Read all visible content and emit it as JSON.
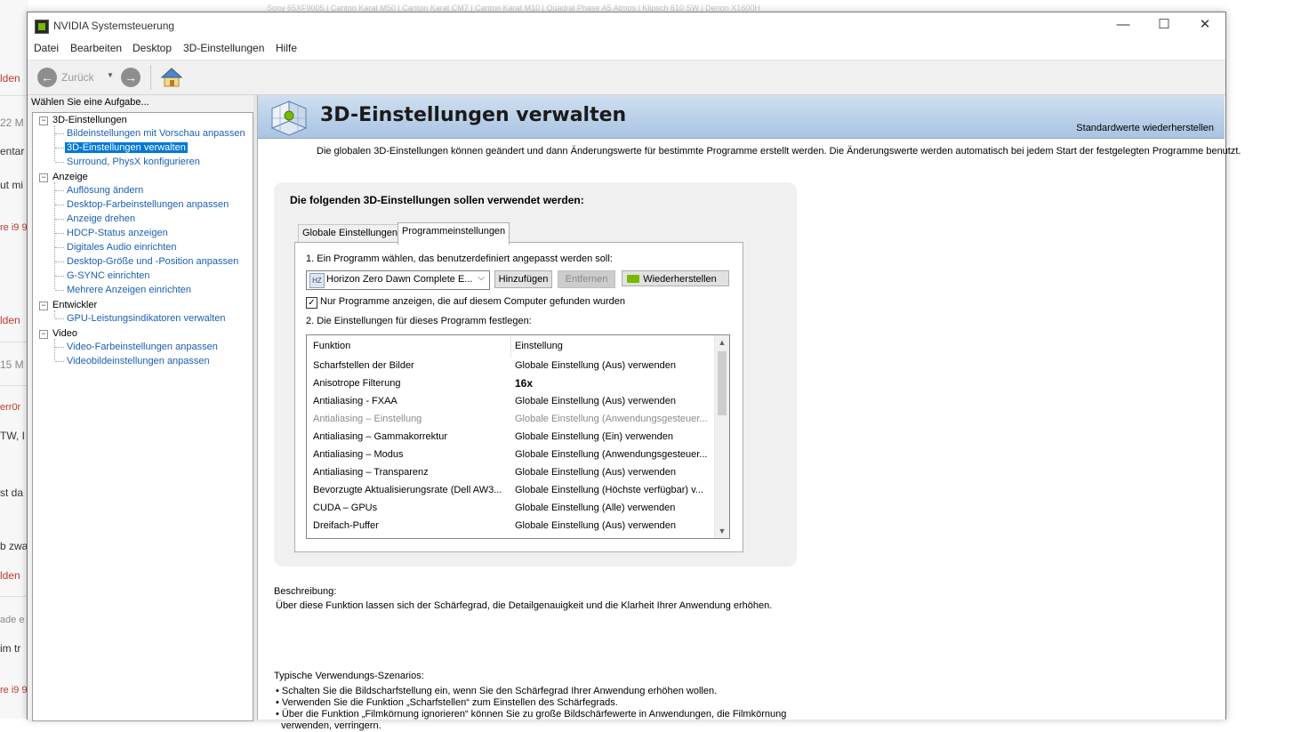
{
  "background": {
    "top_line": "Sony 65XF9005 | Canton Karat M50 | Canton Karat CM7 | Canton Karat M10 | Quadral Phase A5 Atmos | Klipsch 610 SW | Denon X1600H",
    "fragments": [
      "lden",
      "22 M",
      "entar",
      "ut mi",
      "re i9 9",
      "lden",
      "15 M",
      "err0r",
      "TW, I",
      "st da",
      "b zwa",
      "lden",
      "ade e",
      "im tr",
      "re i9 9"
    ]
  },
  "window": {
    "title": "NVIDIA Systemsteuerung",
    "controls": {
      "minimize": "—",
      "maximize": "☐",
      "close": "✕"
    }
  },
  "menu": [
    "Datei",
    "Bearbeiten",
    "Desktop",
    "3D-Einstellungen",
    "Hilfe"
  ],
  "toolbar": {
    "back_label": "Zurück",
    "back_icon": "back-arrow-icon",
    "forward_icon": "forward-arrow-icon",
    "home_icon": "home-icon"
  },
  "sidebar": {
    "header": "Wählen Sie eine Aufgabe...",
    "categories": [
      {
        "label": "3D-Einstellungen",
        "items": [
          "Bildeinstellungen mit Vorschau anpassen",
          "3D-Einstellungen verwalten",
          "Surround, PhysX konfigurieren"
        ]
      },
      {
        "label": "Anzeige",
        "items": [
          "Auflösung ändern",
          "Desktop-Farbeinstellungen anpassen",
          "Anzeige drehen",
          "HDCP-Status anzeigen",
          "Digitales Audio einrichten",
          "Desktop-Größe und -Position anpassen",
          "G-SYNC einrichten",
          "Mehrere Anzeigen einrichten"
        ]
      },
      {
        "label": "Entwickler",
        "items": [
          "GPU-Leistungsindikatoren verwalten"
        ]
      },
      {
        "label": "Video",
        "items": [
          "Video-Farbeinstellungen anpassen",
          "Videobildeinstellungen anpassen"
        ]
      }
    ],
    "selected": "3D-Einstellungen verwalten"
  },
  "main": {
    "title": "3D-Einstellungen verwalten",
    "restore_defaults": "Standardwerte wiederherstellen",
    "intro": "Die globalen 3D-Einstellungen können geändert und dann Änderungswerte für bestimmte Programme erstellt werden. Die Änderungswerte werden automatisch bei jedem Start der festgelegten Programme benutzt.",
    "box_heading": "Die folgenden 3D-Einstellungen sollen verwendet werden:",
    "tabs": [
      "Globale Einstellungen",
      "Programmeinstellungen"
    ],
    "active_tab": 1,
    "step1": "1. Ein Programm wählen, das benutzerdefiniert angepasst werden soll:",
    "program_selected": "Horizon Zero Dawn Complete E...",
    "buttons": {
      "add": "Hinzufügen",
      "remove": "Entfernen",
      "restore": "Wiederherstellen"
    },
    "checkbox_label": "Nur Programme anzeigen, die auf diesem Computer gefunden wurden",
    "checkbox_checked": true,
    "step2": "2. Die Einstellungen für dieses Programm festlegen:",
    "grid_headers": [
      "Funktion",
      "Einstellung"
    ],
    "grid_rows": [
      {
        "function": "Scharfstellen der Bilder",
        "setting": "Globale Einstellung (Aus) verwenden"
      },
      {
        "function": "Anisotrope Filterung",
        "setting": "16x"
      },
      {
        "function": "Antialiasing - FXAA",
        "setting": "Globale Einstellung (Aus) verwenden"
      },
      {
        "function": "Antialiasing – Einstellung",
        "setting": "Globale Einstellung (Anwendungsgesteuer..."
      },
      {
        "function": "Antialiasing – Gammakorrektur",
        "setting": "Globale Einstellung (Ein) verwenden"
      },
      {
        "function": "Antialiasing – Modus",
        "setting": "Globale Einstellung (Anwendungsgesteuer..."
      },
      {
        "function": "Antialiasing – Transparenz",
        "setting": "Globale Einstellung (Aus) verwenden"
      },
      {
        "function": "Bevorzugte Aktualisierungsrate (Dell AW3...",
        "setting": "Globale Einstellung (Höchste verfügbar) v..."
      },
      {
        "function": "CUDA – GPUs",
        "setting": "Globale Einstellung (Alle) verwenden"
      },
      {
        "function": "Dreifach-Puffer",
        "setting": "Globale Einstellung (Aus) verwenden"
      }
    ],
    "description_label": "Beschreibung:",
    "description_text": "Über diese Funktion lassen sich der Schärfegrad, die Detailgenauigkeit und die Klarheit Ihrer Anwendung erhöhen.",
    "usage_label": "Typische Verwendungs-Szenarios:",
    "usage_items": [
      "Schalten Sie die Bildscharfstellung ein, wenn Sie den Schärfegrad Ihrer Anwendung erhöhen wollen.",
      "Verwenden Sie die Funktion „Scharfstellen“ zum Einstellen des Schärfegrads.",
      "Über die Funktion „Filmkörnung ignorieren“ können Sie zu große Bildschärfewerte in Anwendungen, die Filmkörnung",
      "verwenden, verringern."
    ]
  },
  "colors": {
    "nvidia_green": "#76b900",
    "selection": "#0078d7",
    "link": "#1a5fb4",
    "banner": "#b9d0ea"
  }
}
